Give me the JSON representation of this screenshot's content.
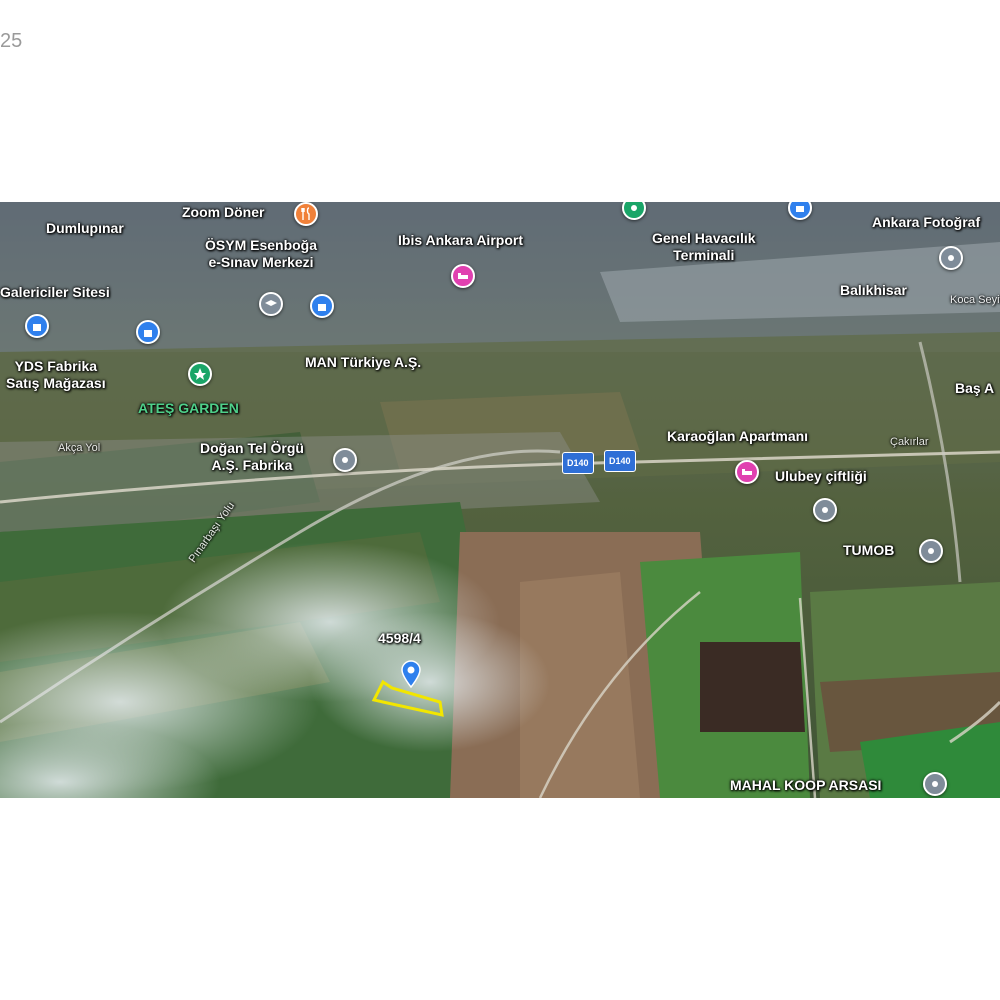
{
  "corner_text": "25",
  "map": {
    "parcel_label": "4598/4",
    "places": {
      "dumlupinar": "Dumlupınar",
      "zoom_doner": "Zoom Döner",
      "osym": "ÖSYM Esenboğa\ne-Sınav Merkezi",
      "ibis": "Ibis Ankara Airport",
      "genel_havacilik": "Genel Havacılık\nTerminali",
      "ankara_fotograf": "Ankara Fotoğraf",
      "galericiler": "Galericiler Sitesi",
      "balikhisar": "Balıkhisar",
      "koca_seyit": "Koca Seyit",
      "yds": "YDS Fabrika\nSatış Mağazası",
      "man": "MAN Türkiye A.Ş.",
      "ates_garden": "ATEŞ GARDEN",
      "bas": "Baş A",
      "dogan": "Doğan Tel Örgü\nA.Ş. Fabrika",
      "karaoglan": "Karaoğlan Apartmanı",
      "ulubey": "Ulubey çiftliği",
      "tumob": "TUMOB",
      "mahal": "MAHAL KOOP ARSASI",
      "akca_yol": "Akça Yol",
      "cakirlar": "Çakırlar",
      "road_label": "Pınarbaşı Yolu"
    },
    "route_shields": [
      "D140",
      "D140"
    ],
    "colors": {
      "pin_blue": "#2f80ed",
      "parcel_outline": "#f2e600",
      "poi_green": "#4fd08a"
    }
  }
}
